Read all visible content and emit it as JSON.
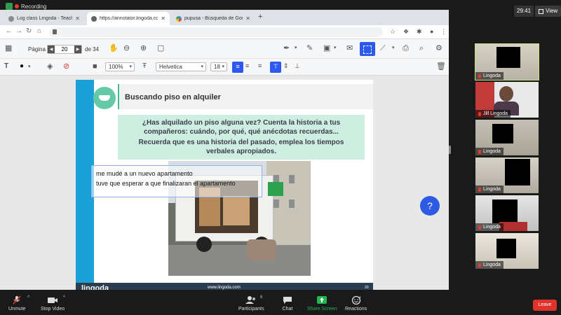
{
  "recording": {
    "label": "Recording"
  },
  "zoom": {
    "timer": "29:41",
    "view_label": "View"
  },
  "browser": {
    "tabs": [
      {
        "title": "Log class Lingoda - Teacher Ar"
      },
      {
        "title": "https://annotator.lingoda.com"
      },
      {
        "title": "pupusa - Búsqueda de Google"
      }
    ]
  },
  "annotator": {
    "page_label": "Página",
    "page_number": "20",
    "page_total": "de 34",
    "zoom_value": "100%",
    "font_name": "Helvetica",
    "font_size": "18"
  },
  "slide": {
    "title": "Buscando piso en alquiler",
    "question_lines": [
      "¿Has alquilado un piso alguna vez? Cuenta la historia a tus",
      "compañeros: cuándo, por qué, qué anécdotas recuerdas...",
      "Recuerda que es una historia del pasado, emplea los tiempos",
      "verbales apropiados."
    ],
    "annotation_lines": [
      "me mudé a un nuevo apartamento",
      "tuve que esperar a que finalizaran el apartamento"
    ],
    "footer_logo": "lingoda",
    "footer_url": "www.lingoda.com",
    "page_no": "20"
  },
  "help": {
    "symbol": "?"
  },
  "participants": [
    {
      "name": "Lingoda",
      "active": true
    },
    {
      "name": "Jill Lingoda",
      "active": false
    },
    {
      "name": "Lingoda",
      "active": false
    },
    {
      "name": "Lingoda",
      "active": false
    },
    {
      "name": "Lingoda",
      "active": false
    },
    {
      "name": "Lingoda",
      "active": false
    }
  ],
  "zoom_bar": {
    "unmute": "Unmute",
    "stop_video": "Stop Video",
    "participants": "Participants",
    "participant_count": "6",
    "chat": "Chat",
    "share_screen": "Share Screen",
    "reactions": "Reactions",
    "leave": "Leave"
  },
  "colors": {
    "accent_blue": "#2e59f0",
    "lingoda_teal": "#64c9a7",
    "question_bg": "#cdeee1",
    "stripe_blue": "#1ba0d8",
    "footer_navy": "#2b3d4f",
    "share_green": "#22b550",
    "leave_red": "#e0322a",
    "active_tile": "#c9e07c"
  }
}
